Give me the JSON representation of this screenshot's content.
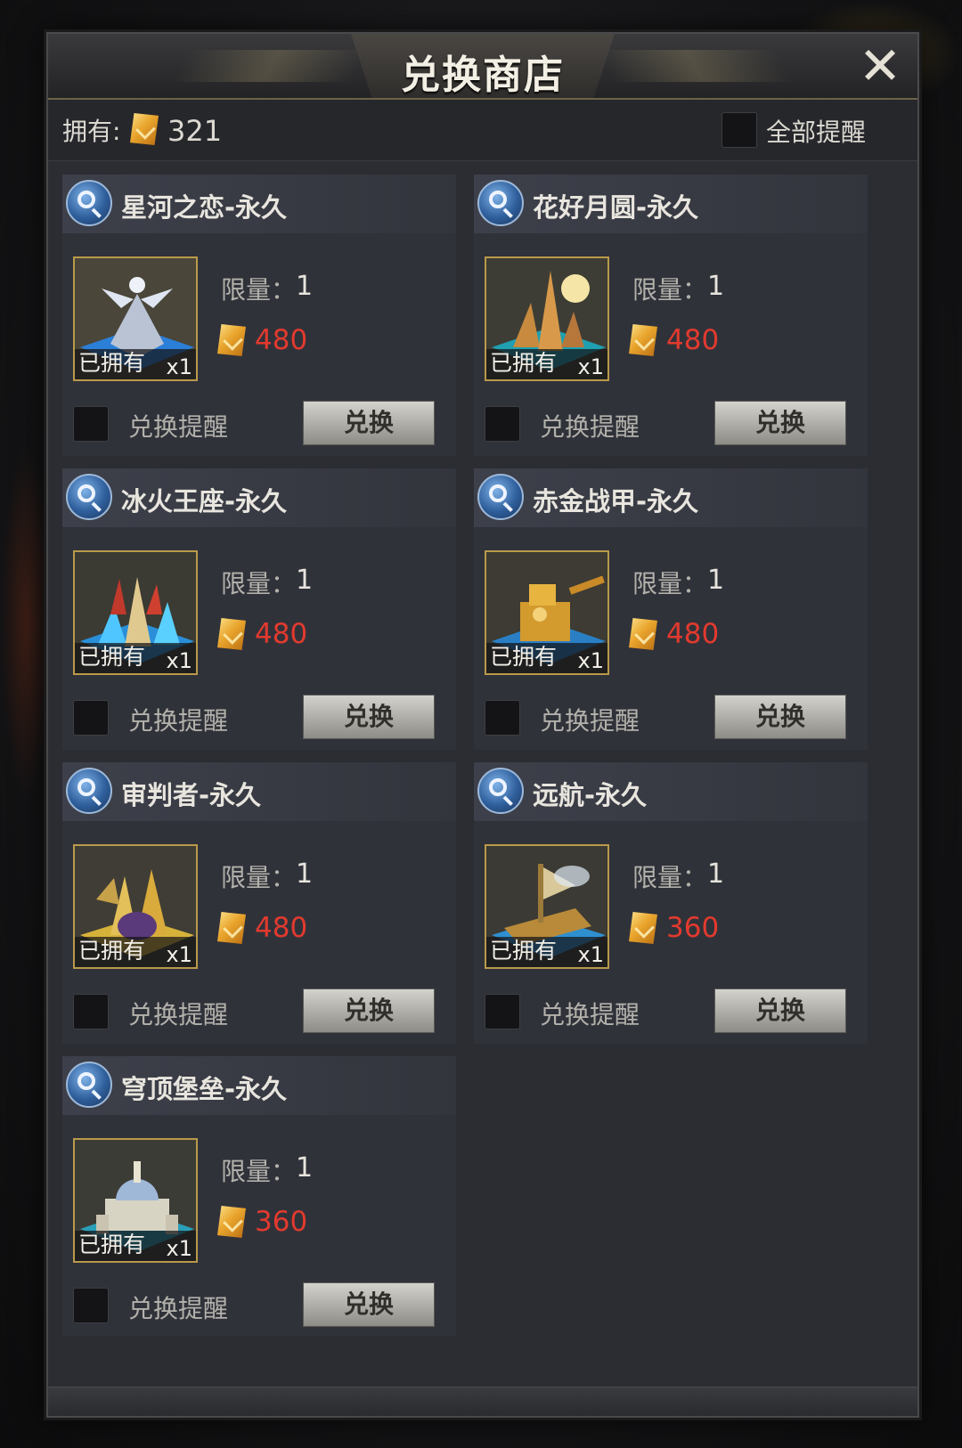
{
  "dialog": {
    "title": "兑换商店",
    "close_icon": "close-icon"
  },
  "header": {
    "own_label": "拥有:",
    "own_value": "321",
    "currency_icon": "gold-coin-icon",
    "remind_all_label": "全部提醒",
    "remind_all_checked": false
  },
  "labels": {
    "limit": "限量：",
    "owned": "已拥有",
    "remind": "兑换提醒",
    "exchange": "兑换"
  },
  "colors": {
    "price": "#e23a2e",
    "frame_gold": "#b99a4a"
  },
  "items": [
    {
      "name": "星河之恋-永久",
      "limit": "1",
      "price": "480",
      "owned": "已拥有",
      "qty": "x1",
      "remind": "兑换提醒",
      "button": "兑换",
      "thumb": "silver-angel-building"
    },
    {
      "name": "花好月圆-永久",
      "limit": "1",
      "price": "480",
      "owned": "已拥有",
      "qty": "x1",
      "remind": "兑换提醒",
      "button": "兑换",
      "thumb": "moon-castle-building"
    },
    {
      "name": "冰火王座-永久",
      "limit": "1",
      "price": "480",
      "owned": "已拥有",
      "qty": "x1",
      "remind": "兑换提醒",
      "button": "兑换",
      "thumb": "ice-fire-throne-building"
    },
    {
      "name": "赤金战甲-永久",
      "limit": "1",
      "price": "480",
      "owned": "已拥有",
      "qty": "x1",
      "remind": "兑换提醒",
      "button": "兑换",
      "thumb": "golden-mech-building"
    },
    {
      "name": "审判者-永久",
      "limit": "1",
      "price": "480",
      "owned": "已拥有",
      "qty": "x1",
      "remind": "兑换提醒",
      "button": "兑换",
      "thumb": "judge-building"
    },
    {
      "name": "远航-永久",
      "limit": "1",
      "price": "360",
      "owned": "已拥有",
      "qty": "x1",
      "remind": "兑换提醒",
      "button": "兑换",
      "thumb": "voyage-ship-building"
    },
    {
      "name": "穹顶堡垒-永久",
      "limit": "1",
      "price": "360",
      "owned": "已拥有",
      "qty": "x1",
      "remind": "兑换提醒",
      "button": "兑换",
      "thumb": "dome-fortress-building"
    }
  ]
}
